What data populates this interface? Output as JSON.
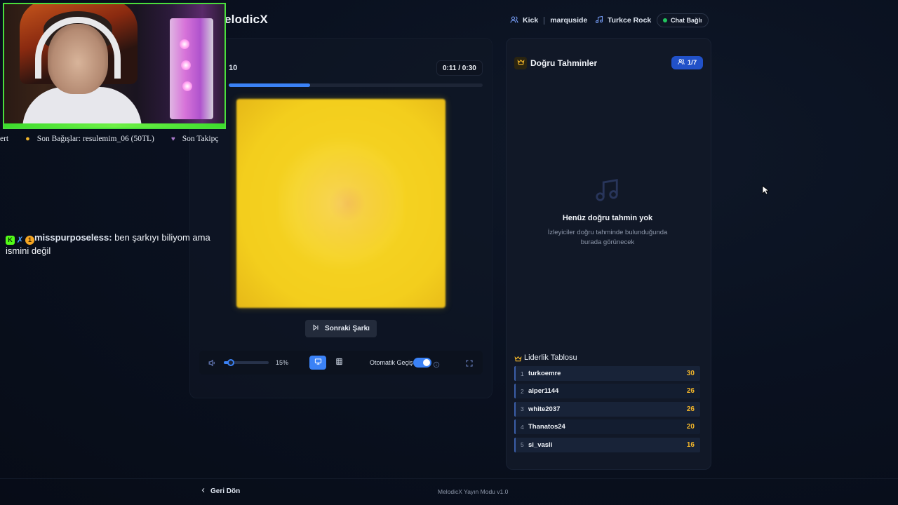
{
  "header": {
    "brand": "elodicX",
    "platform": "Kick",
    "channel": "marquside",
    "playlist": "Turkce Rock",
    "chat_status": "Chat Bağlı"
  },
  "player": {
    "round": "10",
    "elapsed": "0:11",
    "duration": "0:30",
    "time_display": "0:11 / 0:30",
    "progress_fraction": 0.32,
    "next_label": "Sonraki Şarkı",
    "volume_pct": "15%",
    "volume_fraction": 0.15,
    "auto_label": "Otomatik Geçiş",
    "auto_enabled": true
  },
  "correct_guesses": {
    "title": "Doğru Tahminler",
    "count": "1/7",
    "empty_title": "Henüz doğru tahmin yok",
    "empty_sub": "İzleyiciler doğru tahminde bulunduğunda burada görünecek"
  },
  "leaderboard": {
    "title": "Liderlik Tablosu",
    "rows": [
      {
        "rank": "1",
        "name": "turkoemre",
        "score": "30"
      },
      {
        "rank": "2",
        "name": "alper1144",
        "score": "26"
      },
      {
        "rank": "3",
        "name": "white2037",
        "score": "26"
      },
      {
        "rank": "4",
        "name": "Thanatos24",
        "score": "20"
      },
      {
        "rank": "5",
        "name": "si_vasli",
        "score": "16"
      }
    ]
  },
  "footer": {
    "back_label": "Geri Dön",
    "version": "MelodicX Yayın Modu v1.0"
  },
  "overlay": {
    "ticker_prefix": "ert",
    "ticker_donations": "Son Bağışlar: resulemim_06 (50TL)",
    "ticker_followers": "Son Takipç",
    "chat_user": "misspurposeless:",
    "chat_text": "ben şarkıyı biliyom ama ismini değil"
  },
  "colors": {
    "accent": "#3b82f6",
    "score": "#f3b62a",
    "status_green": "#22c55e",
    "webcam_border": "#4ade3c"
  }
}
